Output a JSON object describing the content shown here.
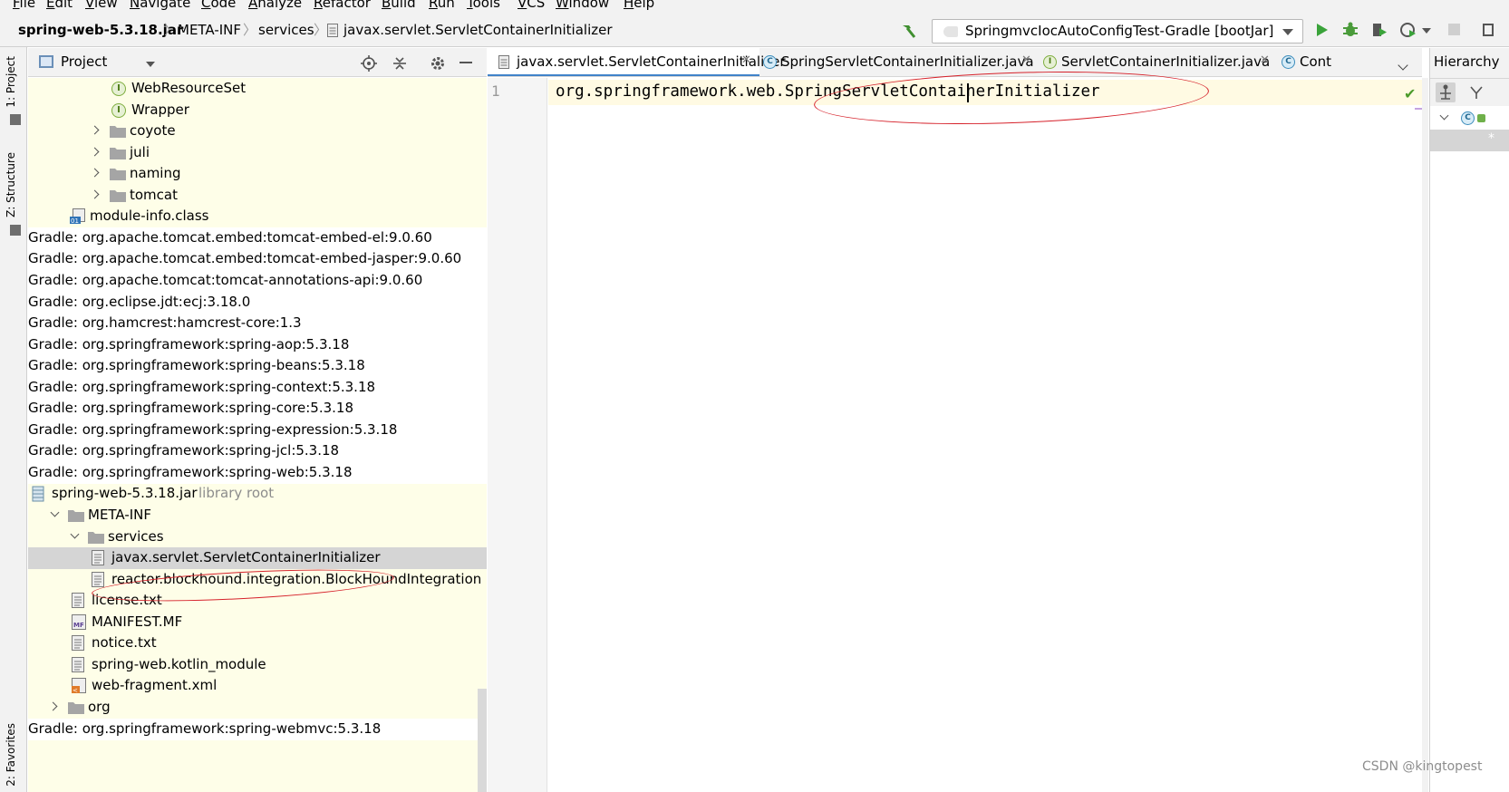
{
  "menu": [
    "File",
    "Edit",
    "View",
    "Navigate",
    "Code",
    "Analyze",
    "Refactor",
    "Build",
    "Run",
    "Tools",
    "VCS",
    "Window",
    "Help"
  ],
  "breadcrumb": {
    "jar": "spring-web-5.3.18.jar",
    "meta_inf": "META-INF",
    "services": "services",
    "file": "javax.servlet.ServletContainerInitializer"
  },
  "run_config": {
    "label": "SpringmvcIocAutoConfigTest-Gradle [bootJar]"
  },
  "side_tabs": {
    "project": "1: Project",
    "structure": "Z: Structure",
    "favorites": "2: Favorites"
  },
  "project_panel": {
    "title": "Project",
    "tree": [
      {
        "text": "WebResourceSet",
        "icon": "interface-icon",
        "style": "lib"
      },
      {
        "text": "Wrapper",
        "icon": "interface-icon",
        "style": "lib"
      },
      {
        "text": "coyote",
        "icon": "folder-icon",
        "expand": "collapsed",
        "style": "lib"
      },
      {
        "text": "juli",
        "icon": "folder-icon",
        "expand": "collapsed",
        "style": "lib"
      },
      {
        "text": "naming",
        "icon": "folder-icon",
        "expand": "collapsed",
        "style": "lib"
      },
      {
        "text": "tomcat",
        "icon": "folder-icon",
        "expand": "collapsed",
        "style": "lib"
      },
      {
        "text": "module-info.class",
        "icon": "class-file-icon",
        "style": "lib"
      },
      {
        "text": "Gradle: org.apache.tomcat.embed:tomcat-embed-el:9.0.60",
        "style": "plain"
      },
      {
        "text": "Gradle: org.apache.tomcat.embed:tomcat-embed-jasper:9.0.60",
        "style": "plain"
      },
      {
        "text": "Gradle: org.apache.tomcat:tomcat-annotations-api:9.0.60",
        "style": "plain"
      },
      {
        "text": "Gradle: org.eclipse.jdt:ecj:3.18.0",
        "style": "plain"
      },
      {
        "text": "Gradle: org.hamcrest:hamcrest-core:1.3",
        "style": "plain"
      },
      {
        "text": "Gradle: org.springframework:spring-aop:5.3.18",
        "style": "plain"
      },
      {
        "text": "Gradle: org.springframework:spring-beans:5.3.18",
        "style": "plain"
      },
      {
        "text": "Gradle: org.springframework:spring-context:5.3.18",
        "style": "plain"
      },
      {
        "text": "Gradle: org.springframework:spring-core:5.3.18",
        "style": "plain"
      },
      {
        "text": "Gradle: org.springframework:spring-expression:5.3.18",
        "style": "plain"
      },
      {
        "text": "Gradle: org.springframework:spring-jcl:5.3.18",
        "style": "plain"
      },
      {
        "text": "Gradle: org.springframework:spring-web:5.3.18",
        "style": "plain"
      },
      {
        "text": "spring-web-5.3.18.jar",
        "hint": "library root",
        "icon": "jar-icon",
        "style": "lib"
      },
      {
        "text": "META-INF",
        "icon": "folder-icon",
        "expand": "expanded",
        "style": "lib"
      },
      {
        "text": "services",
        "icon": "folder-icon",
        "expand": "expanded",
        "style": "lib"
      },
      {
        "text": "javax.servlet.ServletContainerInitializer",
        "icon": "text-file-icon",
        "style": "selected"
      },
      {
        "text": "reactor.blockhound.integration.BlockHoundIntegration",
        "icon": "text-file-icon",
        "style": "lib"
      },
      {
        "text": "license.txt",
        "icon": "text-file-icon",
        "style": "lib"
      },
      {
        "text": "MANIFEST.MF",
        "icon": "manifest-icon",
        "style": "lib"
      },
      {
        "text": "notice.txt",
        "icon": "text-file-icon",
        "style": "lib"
      },
      {
        "text": "spring-web.kotlin_module",
        "icon": "text-file-icon",
        "style": "lib"
      },
      {
        "text": "web-fragment.xml",
        "icon": "xml-file-icon",
        "style": "lib"
      },
      {
        "text": "org",
        "icon": "folder-icon",
        "expand": "collapsed",
        "style": "lib"
      },
      {
        "text": "Gradle: org.springframework:spring-webmvc:5.3.18",
        "style": "plain"
      }
    ]
  },
  "editor_tabs": [
    {
      "label": "javax.servlet.ServletContainerInitializer",
      "icon": "text-file-icon",
      "active": true
    },
    {
      "label": "SpringServletContainerInitializer.java",
      "icon": "class-icon",
      "active": false
    },
    {
      "label": "ServletContainerInitializer.java",
      "icon": "interface-icon",
      "active": false
    },
    {
      "label": "Cont",
      "icon": "class-icon",
      "active": false
    }
  ],
  "editor": {
    "line_number": "1",
    "code": "org.springframework.web.SpringServletContainerInitializer"
  },
  "hierarchy": {
    "title": "Hierarchy"
  },
  "colors": {
    "annotation_ellipse": "#d6222b",
    "library_tree_background": "#fefee8",
    "active_tab_underline": "#4083c9"
  },
  "watermark": "CSDN @kingtopest"
}
